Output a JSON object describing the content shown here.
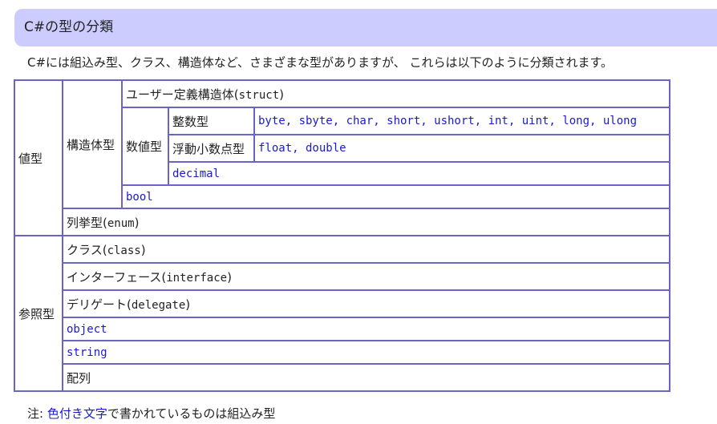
{
  "title": "C#の型の分類",
  "intro": "C#には組込み型、クラス、構造体など、さまざまな型がありますが、 これらは以下のように分類されます。",
  "table": {
    "value_type": "値型",
    "struct_type": "構造体型",
    "user_struct": {
      "text": "ユーザー定義構造体(",
      "code": "struct",
      "close": ")"
    },
    "numeric_type": "数値型",
    "integer_type": "整数型",
    "integer_list": "byte, sbyte, char, short, ushort, int, uint, long, ulong",
    "float_type": "浮動小数点型",
    "float_list": "float, double",
    "decimal": "decimal",
    "bool": "bool",
    "enum_type": {
      "text": "列挙型(",
      "code": "enum",
      "close": ")"
    },
    "reference_type": "参照型",
    "class_type": {
      "text": "クラス(",
      "code": "class",
      "close": ")"
    },
    "interface_type": {
      "text": "インターフェース(",
      "code": "interface",
      "close": ")"
    },
    "delegate_type": {
      "text": "デリゲート(",
      "code": "delegate",
      "close": ")"
    },
    "object": "object",
    "string": "string",
    "array": "配列"
  },
  "note": {
    "prefix": "注: ",
    "highlight": "色付き文字",
    "suffix": "で書かれているものは組込み型"
  },
  "colors": {
    "title_background": "#ccccff",
    "table_border": "#6a64c8",
    "builtin_text": "#1a1acc"
  }
}
